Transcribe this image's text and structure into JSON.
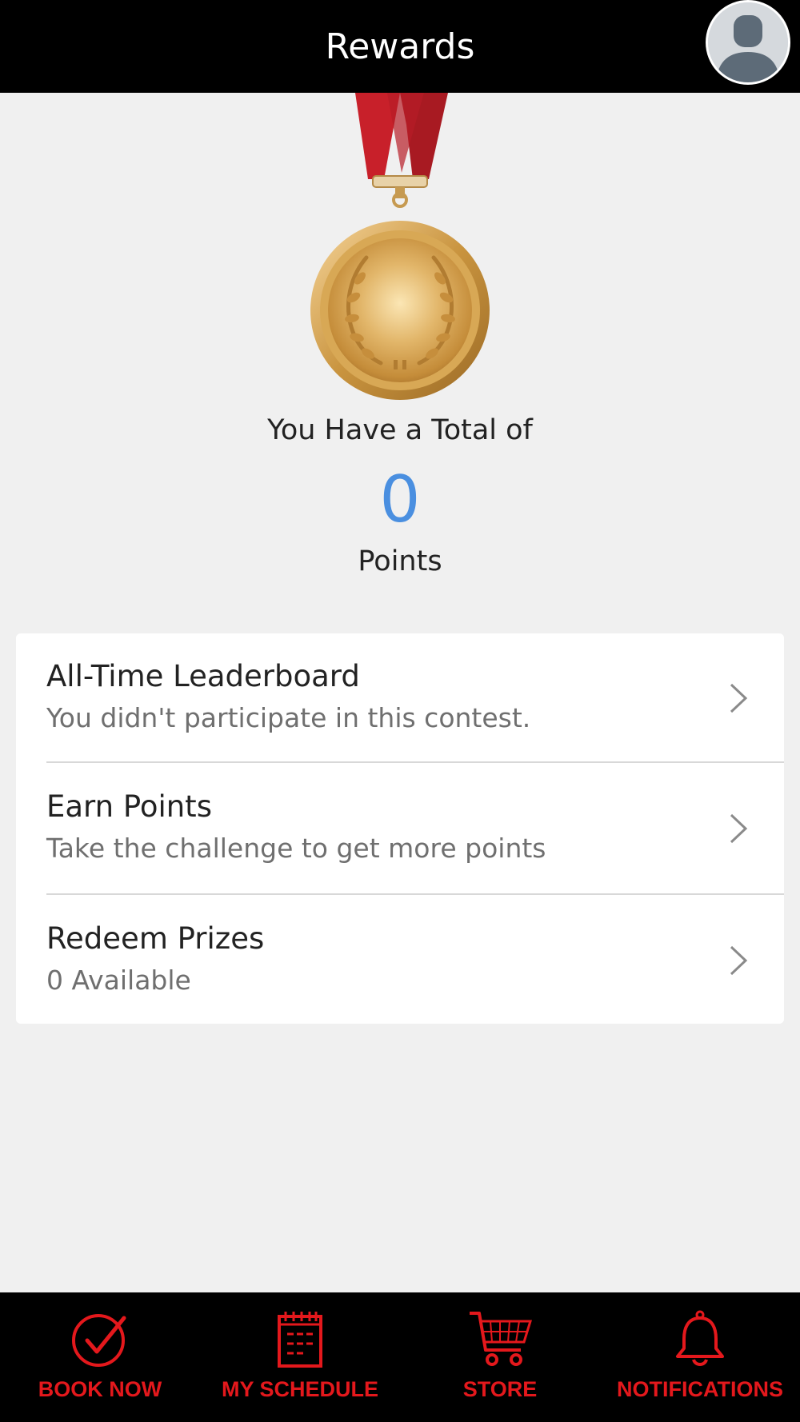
{
  "header": {
    "title": "Rewards",
    "avatar_icon": "user-avatar-icon"
  },
  "summary": {
    "total_label": "You Have a Total of",
    "points": "0",
    "points_label": "Points",
    "medal_icon": "gold-medal-icon"
  },
  "menu": [
    {
      "title": "All-Time Leaderboard",
      "subtitle": "You didn't participate in this contest.",
      "icon": "chevron-right-icon"
    },
    {
      "title": "Earn Points",
      "subtitle": "Take the challenge to get more points",
      "icon": "chevron-right-icon"
    },
    {
      "title": "Redeem Prizes",
      "subtitle": "0 Available",
      "icon": "chevron-right-icon"
    }
  ],
  "bottom_nav": [
    {
      "label": "BOOK NOW",
      "icon": "check-circle-icon"
    },
    {
      "label": "MY SCHEDULE",
      "icon": "calendar-icon"
    },
    {
      "label": "STORE",
      "icon": "cart-icon"
    },
    {
      "label": "NOTIFICATIONS",
      "icon": "bell-icon"
    }
  ],
  "colors": {
    "header_bg": "#000000",
    "accent_red": "#e4181c",
    "points_blue": "#4a8fe0",
    "ribbon_red": "#c8202a",
    "medal_gold": "#d9a441"
  }
}
